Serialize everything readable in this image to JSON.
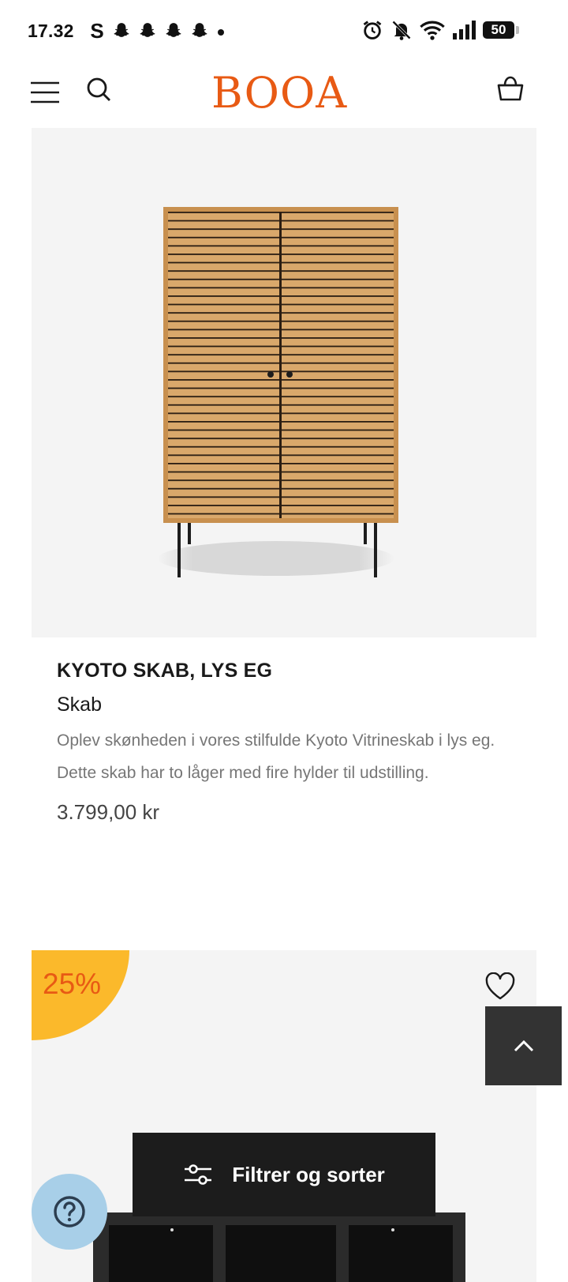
{
  "status_bar": {
    "time": "17.32",
    "left_app_icon": "S",
    "battery": "50"
  },
  "header": {
    "logo": "BOOA",
    "icons": [
      "menu-icon",
      "search-icon",
      "basket-icon"
    ]
  },
  "products": [
    {
      "title": "KYOTO SKAB, LYS EG",
      "category": "Skab",
      "description": "Oplev skønheden i vores stilfulde Kyoto Vitrineskab i lys eg. Dette skab har to låger med fire hylder til udstilling.",
      "price": "3.799,00 kr"
    },
    {
      "badge": "25%"
    }
  ],
  "filter_button": {
    "label": "Filtrer og sorter"
  },
  "colors": {
    "brand": "#e85a14",
    "badge": "#fbb92b",
    "help": "#a8cfe8"
  }
}
